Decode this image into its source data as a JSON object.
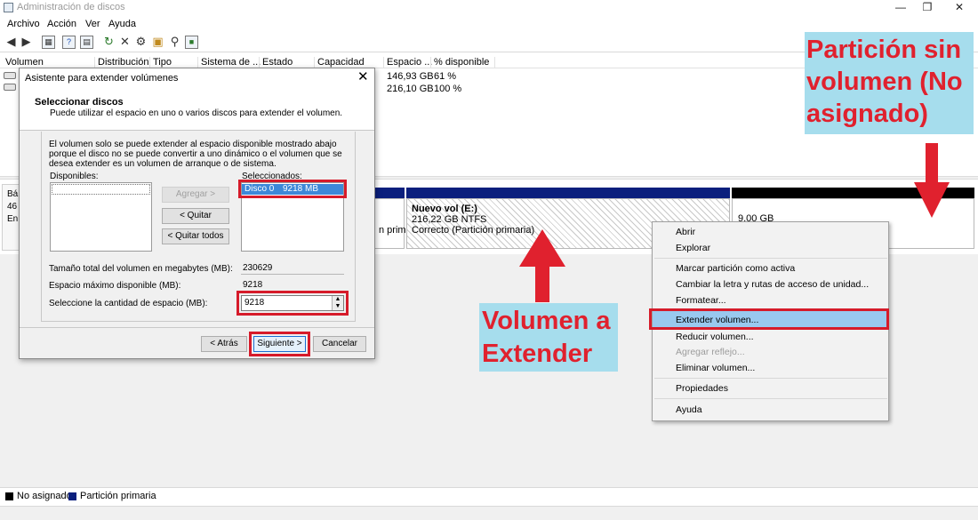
{
  "window": {
    "title": "Administración de discos",
    "controls": {
      "minimize": "—",
      "restore": "❐",
      "close": "✕"
    }
  },
  "menu": [
    "Archivo",
    "Acción",
    "Ver",
    "Ayuda"
  ],
  "toolbar_icons": [
    "back-icon",
    "forward-icon",
    "console-tree-icon",
    "help-icon",
    "properties-icon",
    "refresh-icon",
    "delete-icon",
    "settings-icon",
    "open-folder-icon",
    "search-icon",
    "disk-properties-icon"
  ],
  "volume_list": {
    "columns": [
      "Volumen",
      "Distribución",
      "Tipo",
      "Sistema de ...",
      "Estado",
      "Capacidad",
      "Espacio ...",
      "% disponible"
    ],
    "rows": [
      {
        "free": "146,93 GB",
        "percent": "61 %"
      },
      {
        "free": "216,10 GB",
        "percent": "100 %"
      }
    ]
  },
  "disk_view": {
    "disk_label_fragments": [
      "Bá",
      "46",
      "En"
    ],
    "partition_fragment": "n prim",
    "volume_e": {
      "title": "Nuevo vol  (E:)",
      "size": "216,22 GB NTFS",
      "status": "Correcto (Partición primaria)"
    },
    "unallocated_size": "9,00 GB"
  },
  "legend": {
    "unallocated": "No asignado",
    "primary": "Partición primaria"
  },
  "colors": {
    "primary": "#0b1f7d",
    "unallocated": "#000000",
    "annotation_text": "#e0212e",
    "annotation_bg": "#a6dded",
    "highlight_box": "#d61b2a"
  },
  "wizard": {
    "title": "Asistente para extender volúmenes",
    "heading": "Seleccionar discos",
    "subheading": "Puede utilizar el espacio en uno o varios discos para extender el volumen.",
    "description": "El volumen solo se puede extender al espacio disponible mostrado abajo porque el disco no se puede convertir a uno dinámico o el volumen que se desea extender es un volumen de arranque o de sistema.",
    "available_label": "Disponibles:",
    "selected_label": "Seleccionados:",
    "selected_items": [
      {
        "disk": "Disco 0",
        "size": "9218 MB"
      }
    ],
    "add_button": "Agregar >",
    "remove_button": "< Quitar",
    "remove_all_button": "< Quitar todos",
    "total_size_label": "Tamaño total del volumen en megabytes (MB):",
    "total_size_value": "230629",
    "max_space_label": "Espacio máximo disponible (MB):",
    "max_space_value": "9218",
    "select_space_label": "Seleccione la cantidad de espacio (MB):",
    "select_space_value": "9218",
    "back_button": "< Atrás",
    "next_button": "Siguiente >",
    "cancel_button": "Cancelar"
  },
  "context_menu": {
    "items": [
      {
        "label": "Abrir",
        "enabled": true
      },
      {
        "label": "Explorar",
        "enabled": true
      },
      {
        "label": "Marcar partición como activa",
        "enabled": true
      },
      {
        "label": "Cambiar la letra y rutas de acceso de unidad...",
        "enabled": true
      },
      {
        "label": "Formatear...",
        "enabled": true
      },
      {
        "label": "Extender volumen...",
        "enabled": true,
        "highlighted": true
      },
      {
        "label": "Reducir volumen...",
        "enabled": true
      },
      {
        "label": "Agregar reflejo...",
        "enabled": false
      },
      {
        "label": "Eliminar volumen...",
        "enabled": true
      },
      {
        "label": "Propiedades",
        "enabled": true
      },
      {
        "label": "Ayuda",
        "enabled": true
      }
    ]
  },
  "annotations": {
    "unallocated_callout": "Partición sin volumen (No asignado)",
    "extend_callout": "Volumen a Extender"
  }
}
